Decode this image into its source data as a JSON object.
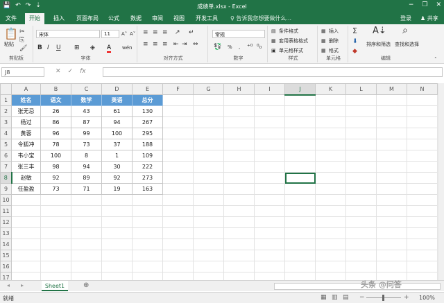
{
  "window": {
    "title": "成绩单.xlsx - Excel",
    "minimize": "−",
    "restore": "❐",
    "close": "✕"
  },
  "qat": {
    "save": "💾",
    "undo": "↶",
    "redo": "↷",
    "customize": "⇣"
  },
  "ribbon_tabs": [
    "文件",
    "开始",
    "插入",
    "页面布局",
    "公式",
    "数据",
    "审阅",
    "视图",
    "开发工具"
  ],
  "active_tab": "开始",
  "tell_me": "♀ 告诉我您想要做什么...",
  "account": {
    "login": "登录",
    "share": "♟ 共享"
  },
  "ribbon": {
    "clipboard": {
      "paste": "粘贴",
      "label": "剪贴板"
    },
    "font": {
      "name": "宋体",
      "size": "11",
      "grow": "A˄",
      "shrink": "A˅",
      "bold": "B",
      "italic": "I",
      "underline": "U",
      "phonetic": "wén",
      "label": "字体"
    },
    "alignment": {
      "label": "对齐方式"
    },
    "number": {
      "format": "常规",
      "percent": "%",
      "comma": ",",
      "label": "数字"
    },
    "styles": {
      "conditional": "条件格式",
      "table": "套用表格格式",
      "cell": "单元格样式",
      "label": "样式"
    },
    "cells": {
      "insert": "插入",
      "delete": "删除",
      "format": "格式",
      "label": "单元格"
    },
    "editing": {
      "sort": "排序和筛选",
      "find": "查找和选择",
      "label": "编辑"
    }
  },
  "formula_bar": {
    "name_box": "J8",
    "cancel": "✕",
    "enter": "✓",
    "fx": "fx",
    "value": ""
  },
  "columns": [
    "A",
    "B",
    "C",
    "D",
    "E",
    "F",
    "G",
    "H",
    "I",
    "J",
    "K",
    "L",
    "M",
    "N"
  ],
  "selected": {
    "col": "J",
    "row": 8
  },
  "rows": 19,
  "table": {
    "headers": [
      "姓名",
      "语文",
      "数学",
      "英语",
      "总分"
    ],
    "rows": [
      [
        "张无忌",
        "26",
        "43",
        "61",
        "130"
      ],
      [
        "杨过",
        "86",
        "87",
        "94",
        "267"
      ],
      [
        "黄蓉",
        "96",
        "99",
        "100",
        "295"
      ],
      [
        "令狐冲",
        "78",
        "73",
        "37",
        "188"
      ],
      [
        "韦小宝",
        "100",
        "8",
        "1",
        "109"
      ],
      [
        "张三丰",
        "98",
        "94",
        "30",
        "222"
      ],
      [
        "赵敏",
        "92",
        "89",
        "92",
        "273"
      ],
      [
        "任盈盈",
        "73",
        "71",
        "19",
        "163"
      ]
    ]
  },
  "sheets": [
    "Sheet1"
  ],
  "status": {
    "ready": "就绪",
    "zoom": "100%",
    "watermark": "头条 @问答"
  },
  "colors": {
    "excel_green": "#217346",
    "header_blue": "#5b9bd5"
  }
}
